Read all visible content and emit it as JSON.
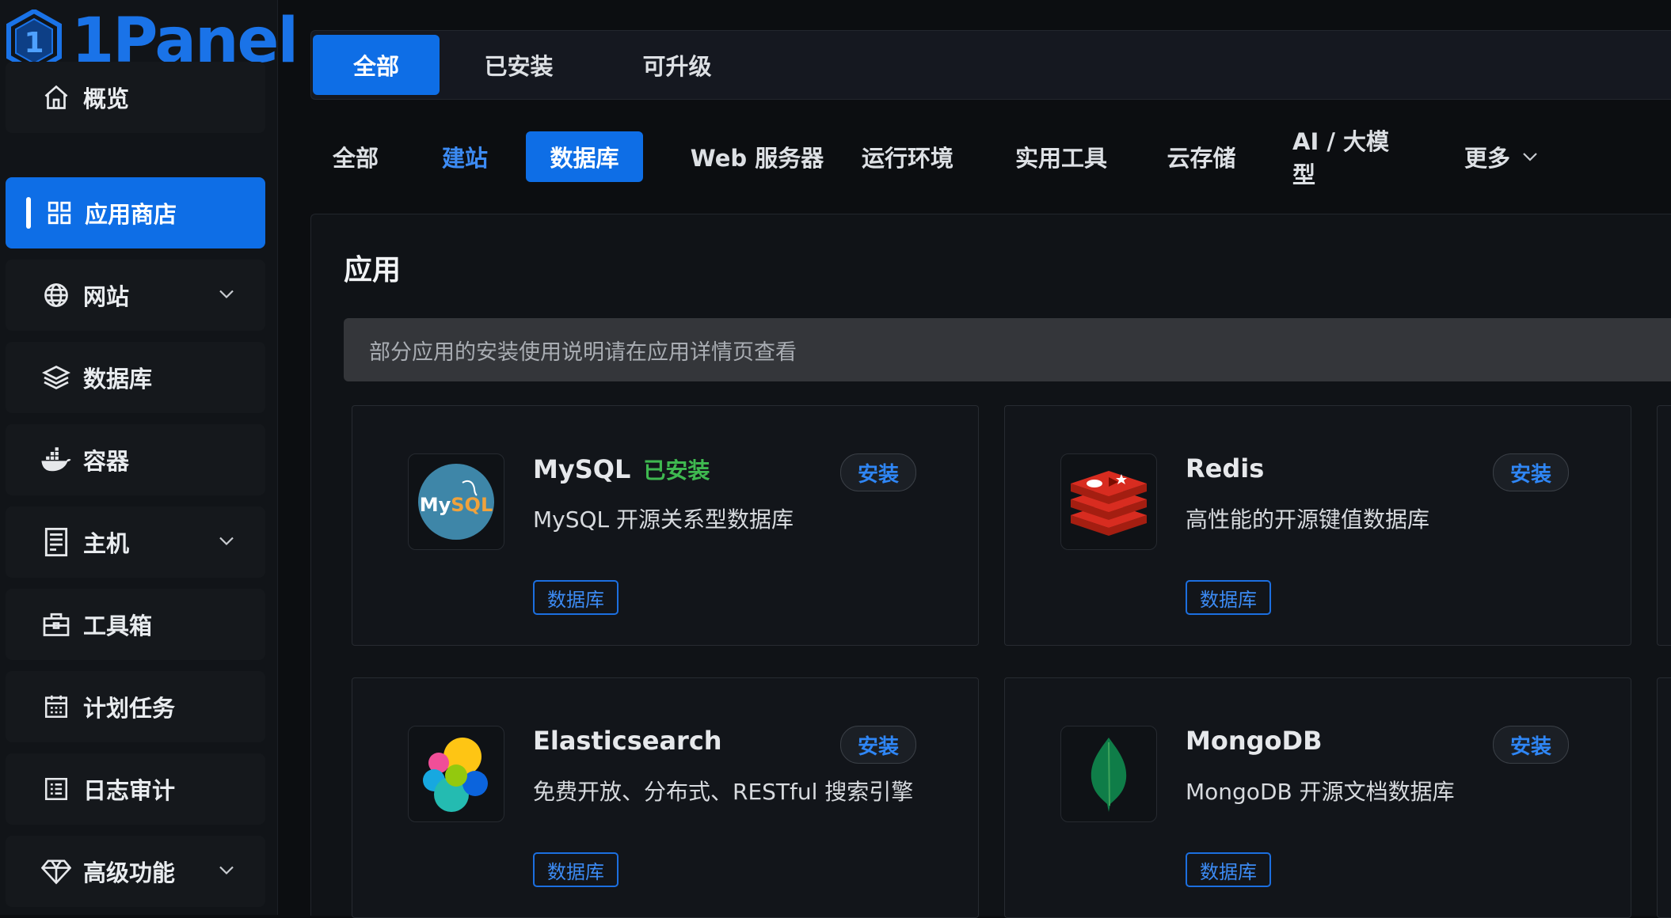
{
  "brand": {
    "name": "1Panel"
  },
  "sidebar": {
    "items": [
      {
        "label": "概览",
        "icon": "home-icon"
      },
      {
        "label": "应用商店",
        "icon": "grid-icon",
        "active": true
      },
      {
        "label": "网站",
        "icon": "globe-icon",
        "expandable": true
      },
      {
        "label": "数据库",
        "icon": "layers-icon"
      },
      {
        "label": "容器",
        "icon": "docker-icon"
      },
      {
        "label": "主机",
        "icon": "server-icon",
        "expandable": true
      },
      {
        "label": "工具箱",
        "icon": "toolbox-icon"
      },
      {
        "label": "计划任务",
        "icon": "calendar-icon"
      },
      {
        "label": "日志审计",
        "icon": "log-icon"
      },
      {
        "label": "高级功能",
        "icon": "diamond-icon",
        "expandable": true
      }
    ]
  },
  "top_tabs": [
    {
      "label": "全部",
      "active": true
    },
    {
      "label": "已安装"
    },
    {
      "label": "可升级"
    }
  ],
  "categories": [
    {
      "label": "全部"
    },
    {
      "label": "建站"
    },
    {
      "label": "数据库",
      "active": true
    },
    {
      "label": "Web 服务器"
    },
    {
      "label": "运行环境"
    },
    {
      "label": "实用工具"
    },
    {
      "label": "云存储"
    },
    {
      "label": "AI / 大模型"
    },
    {
      "label": "更多"
    }
  ],
  "main": {
    "title": "应用",
    "notice": "部分应用的安装使用说明请在应用详情页查看"
  },
  "apps": [
    {
      "name": "MySQL",
      "status": "已安装",
      "description": "MySQL 开源关系型数据库",
      "tag": "数据库",
      "install_label": "安装",
      "icon": "mysql-logo-icon"
    },
    {
      "name": "Redis",
      "status": "",
      "description": "高性能的开源键值数据库",
      "tag": "数据库",
      "install_label": "安装",
      "icon": "redis-logo-icon"
    },
    {
      "name": "Elasticsearch",
      "status": "",
      "description": "免费开放、分布式、RESTful 搜索引擎",
      "tag": "数据库",
      "install_label": "安装",
      "icon": "elasticsearch-logo-icon"
    },
    {
      "name": "MongoDB",
      "status": "",
      "description": "MongoDB 开源文档数据库",
      "tag": "数据库",
      "install_label": "安装",
      "icon": "mongodb-logo-icon"
    }
  ],
  "colors": {
    "accent": "#0e6ee6",
    "installed": "#3fb950",
    "link": "#3c8bf4"
  }
}
